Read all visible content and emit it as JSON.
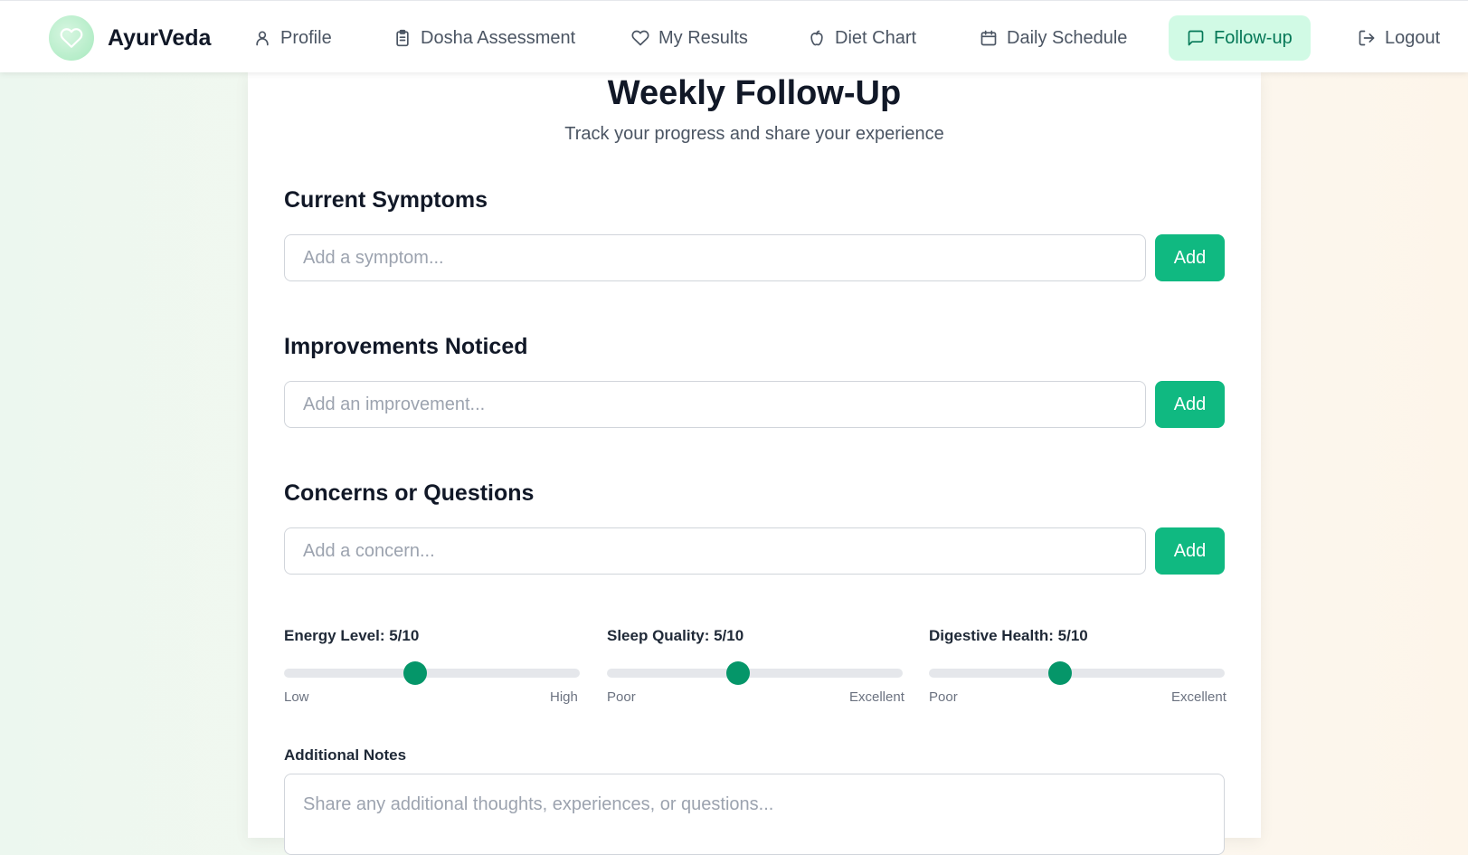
{
  "brand": {
    "name": "AyurVeda"
  },
  "nav": {
    "items": [
      {
        "label": "Profile",
        "icon": "user-icon"
      },
      {
        "label": "Dosha Assessment",
        "icon": "clipboard-icon"
      },
      {
        "label": "My Results",
        "icon": "heart-icon"
      },
      {
        "label": "Diet Chart",
        "icon": "apple-icon"
      },
      {
        "label": "Daily Schedule",
        "icon": "calendar-icon"
      },
      {
        "label": "Follow-up",
        "icon": "message-square-icon",
        "active": true
      },
      {
        "label": "Logout",
        "icon": "logout-icon"
      }
    ]
  },
  "page": {
    "title": "Weekly Follow-Up",
    "subtitle": "Track your progress and share your experience"
  },
  "sections": {
    "symptoms": {
      "title": "Current Symptoms",
      "placeholder": "Add a symptom...",
      "button": "Add"
    },
    "improvements": {
      "title": "Improvements Noticed",
      "placeholder": "Add an improvement...",
      "button": "Add"
    },
    "concerns": {
      "title": "Concerns or Questions",
      "placeholder": "Add a concern...",
      "button": "Add"
    }
  },
  "sliders": {
    "energy": {
      "label": "Energy Level: 5/10",
      "value": 5,
      "max": 10,
      "min_label": "Low",
      "max_label": "High"
    },
    "sleep": {
      "label": "Sleep Quality: 5/10",
      "value": 5,
      "max": 10,
      "min_label": "Poor",
      "max_label": "Excellent"
    },
    "digestive": {
      "label": "Digestive Health: 5/10",
      "value": 5,
      "max": 10,
      "min_label": "Poor",
      "max_label": "Excellent"
    }
  },
  "notes": {
    "label": "Additional Notes",
    "placeholder": "Share any additional thoughts, experiences, or questions..."
  },
  "colors": {
    "accent": "#10b981",
    "accent_dark": "#059669",
    "active_nav_bg": "#d1fae5",
    "active_nav_text": "#047857"
  }
}
